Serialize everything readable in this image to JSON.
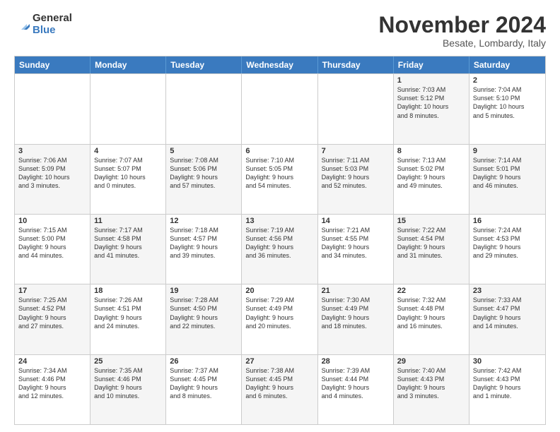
{
  "logo": {
    "general": "General",
    "blue": "Blue"
  },
  "title": "November 2024",
  "location": "Besate, Lombardy, Italy",
  "headers": [
    "Sunday",
    "Monday",
    "Tuesday",
    "Wednesday",
    "Thursday",
    "Friday",
    "Saturday"
  ],
  "rows": [
    [
      {
        "day": "",
        "info": "",
        "shaded": false,
        "empty": true
      },
      {
        "day": "",
        "info": "",
        "shaded": false,
        "empty": true
      },
      {
        "day": "",
        "info": "",
        "shaded": false,
        "empty": true
      },
      {
        "day": "",
        "info": "",
        "shaded": false,
        "empty": true
      },
      {
        "day": "",
        "info": "",
        "shaded": false,
        "empty": true
      },
      {
        "day": "1",
        "info": "Sunrise: 7:03 AM\nSunset: 5:12 PM\nDaylight: 10 hours\nand 8 minutes.",
        "shaded": true,
        "empty": false
      },
      {
        "day": "2",
        "info": "Sunrise: 7:04 AM\nSunset: 5:10 PM\nDaylight: 10 hours\nand 5 minutes.",
        "shaded": false,
        "empty": false
      }
    ],
    [
      {
        "day": "3",
        "info": "Sunrise: 7:06 AM\nSunset: 5:09 PM\nDaylight: 10 hours\nand 3 minutes.",
        "shaded": true,
        "empty": false
      },
      {
        "day": "4",
        "info": "Sunrise: 7:07 AM\nSunset: 5:07 PM\nDaylight: 10 hours\nand 0 minutes.",
        "shaded": false,
        "empty": false
      },
      {
        "day": "5",
        "info": "Sunrise: 7:08 AM\nSunset: 5:06 PM\nDaylight: 9 hours\nand 57 minutes.",
        "shaded": true,
        "empty": false
      },
      {
        "day": "6",
        "info": "Sunrise: 7:10 AM\nSunset: 5:05 PM\nDaylight: 9 hours\nand 54 minutes.",
        "shaded": false,
        "empty": false
      },
      {
        "day": "7",
        "info": "Sunrise: 7:11 AM\nSunset: 5:03 PM\nDaylight: 9 hours\nand 52 minutes.",
        "shaded": true,
        "empty": false
      },
      {
        "day": "8",
        "info": "Sunrise: 7:13 AM\nSunset: 5:02 PM\nDaylight: 9 hours\nand 49 minutes.",
        "shaded": false,
        "empty": false
      },
      {
        "day": "9",
        "info": "Sunrise: 7:14 AM\nSunset: 5:01 PM\nDaylight: 9 hours\nand 46 minutes.",
        "shaded": true,
        "empty": false
      }
    ],
    [
      {
        "day": "10",
        "info": "Sunrise: 7:15 AM\nSunset: 5:00 PM\nDaylight: 9 hours\nand 44 minutes.",
        "shaded": false,
        "empty": false
      },
      {
        "day": "11",
        "info": "Sunrise: 7:17 AM\nSunset: 4:58 PM\nDaylight: 9 hours\nand 41 minutes.",
        "shaded": true,
        "empty": false
      },
      {
        "day": "12",
        "info": "Sunrise: 7:18 AM\nSunset: 4:57 PM\nDaylight: 9 hours\nand 39 minutes.",
        "shaded": false,
        "empty": false
      },
      {
        "day": "13",
        "info": "Sunrise: 7:19 AM\nSunset: 4:56 PM\nDaylight: 9 hours\nand 36 minutes.",
        "shaded": true,
        "empty": false
      },
      {
        "day": "14",
        "info": "Sunrise: 7:21 AM\nSunset: 4:55 PM\nDaylight: 9 hours\nand 34 minutes.",
        "shaded": false,
        "empty": false
      },
      {
        "day": "15",
        "info": "Sunrise: 7:22 AM\nSunset: 4:54 PM\nDaylight: 9 hours\nand 31 minutes.",
        "shaded": true,
        "empty": false
      },
      {
        "day": "16",
        "info": "Sunrise: 7:24 AM\nSunset: 4:53 PM\nDaylight: 9 hours\nand 29 minutes.",
        "shaded": false,
        "empty": false
      }
    ],
    [
      {
        "day": "17",
        "info": "Sunrise: 7:25 AM\nSunset: 4:52 PM\nDaylight: 9 hours\nand 27 minutes.",
        "shaded": true,
        "empty": false
      },
      {
        "day": "18",
        "info": "Sunrise: 7:26 AM\nSunset: 4:51 PM\nDaylight: 9 hours\nand 24 minutes.",
        "shaded": false,
        "empty": false
      },
      {
        "day": "19",
        "info": "Sunrise: 7:28 AM\nSunset: 4:50 PM\nDaylight: 9 hours\nand 22 minutes.",
        "shaded": true,
        "empty": false
      },
      {
        "day": "20",
        "info": "Sunrise: 7:29 AM\nSunset: 4:49 PM\nDaylight: 9 hours\nand 20 minutes.",
        "shaded": false,
        "empty": false
      },
      {
        "day": "21",
        "info": "Sunrise: 7:30 AM\nSunset: 4:49 PM\nDaylight: 9 hours\nand 18 minutes.",
        "shaded": true,
        "empty": false
      },
      {
        "day": "22",
        "info": "Sunrise: 7:32 AM\nSunset: 4:48 PM\nDaylight: 9 hours\nand 16 minutes.",
        "shaded": false,
        "empty": false
      },
      {
        "day": "23",
        "info": "Sunrise: 7:33 AM\nSunset: 4:47 PM\nDaylight: 9 hours\nand 14 minutes.",
        "shaded": true,
        "empty": false
      }
    ],
    [
      {
        "day": "24",
        "info": "Sunrise: 7:34 AM\nSunset: 4:46 PM\nDaylight: 9 hours\nand 12 minutes.",
        "shaded": false,
        "empty": false
      },
      {
        "day": "25",
        "info": "Sunrise: 7:35 AM\nSunset: 4:46 PM\nDaylight: 9 hours\nand 10 minutes.",
        "shaded": true,
        "empty": false
      },
      {
        "day": "26",
        "info": "Sunrise: 7:37 AM\nSunset: 4:45 PM\nDaylight: 9 hours\nand 8 minutes.",
        "shaded": false,
        "empty": false
      },
      {
        "day": "27",
        "info": "Sunrise: 7:38 AM\nSunset: 4:45 PM\nDaylight: 9 hours\nand 6 minutes.",
        "shaded": true,
        "empty": false
      },
      {
        "day": "28",
        "info": "Sunrise: 7:39 AM\nSunset: 4:44 PM\nDaylight: 9 hours\nand 4 minutes.",
        "shaded": false,
        "empty": false
      },
      {
        "day": "29",
        "info": "Sunrise: 7:40 AM\nSunset: 4:43 PM\nDaylight: 9 hours\nand 3 minutes.",
        "shaded": true,
        "empty": false
      },
      {
        "day": "30",
        "info": "Sunrise: 7:42 AM\nSunset: 4:43 PM\nDaylight: 9 hours\nand 1 minute.",
        "shaded": false,
        "empty": false
      }
    ]
  ]
}
